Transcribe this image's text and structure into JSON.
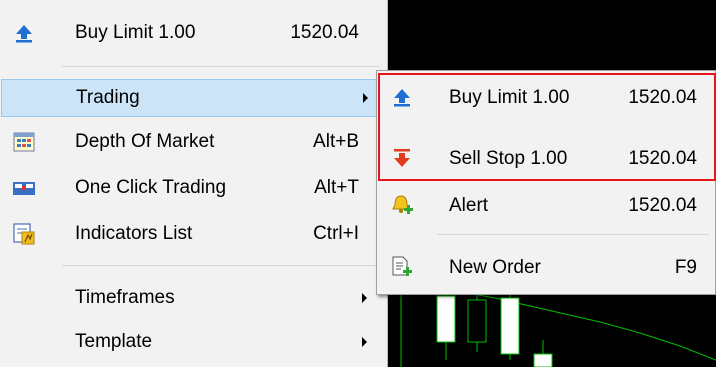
{
  "colors": {
    "menu_bg": "#f2f2f2",
    "hover_bg": "#cce4f7",
    "highlight_border": "#e8141c",
    "buy_arrow": "#1e6fd0",
    "sell_arrow": "#e03c1e",
    "chart_bg": "#000000",
    "chart_line": "#00c000"
  },
  "main_menu": {
    "items": [
      {
        "label": "Buy Limit 1.00",
        "value": "1520.04",
        "icon": "buy-arrow-icon"
      },
      {
        "label": "Trading",
        "value": "",
        "icon": "",
        "has_submenu": true
      },
      {
        "label": "Depth Of Market",
        "value": "Alt+B",
        "icon": "depth-of-market-icon"
      },
      {
        "label": "One Click Trading",
        "value": "Alt+T",
        "icon": "one-click-trading-icon"
      },
      {
        "label": "Indicators List",
        "value": "Ctrl+I",
        "icon": "indicators-list-icon"
      },
      {
        "label": "Timeframes",
        "value": "",
        "icon": "",
        "has_submenu": true
      },
      {
        "label": "Template",
        "value": "",
        "icon": "",
        "has_submenu": true
      }
    ]
  },
  "sub_menu": {
    "items": [
      {
        "label": "Buy Limit 1.00",
        "value": "1520.04",
        "icon": "buy-arrow-icon"
      },
      {
        "label": "Sell Stop 1.00",
        "value": "1520.04",
        "icon": "sell-arrow-icon"
      },
      {
        "label": "Alert",
        "value": "1520.04",
        "icon": "alert-bell-icon"
      },
      {
        "label": "New Order",
        "value": "F9",
        "icon": "new-order-icon"
      }
    ]
  }
}
